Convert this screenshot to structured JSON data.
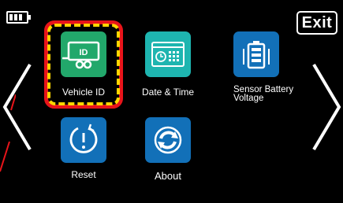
{
  "header": {
    "battery_icon": "battery-icon",
    "exit_label": "Exit"
  },
  "menu": {
    "items": [
      {
        "label": "Vehicle ID",
        "icon": "trailer-id-icon",
        "color": "#22a86b",
        "selected": true
      },
      {
        "label": "Date & Time",
        "icon": "calendar-clock-icon",
        "color": "#1eb5b0",
        "selected": false
      },
      {
        "label_line1": "Sensor Battery",
        "label_line2": "Voltage",
        "icon": "battery-level-icon",
        "color": "#1270b8",
        "selected": false
      },
      {
        "label": "Reset",
        "icon": "power-reset-icon",
        "color": "#1270b8",
        "selected": false
      },
      {
        "label": "About",
        "icon": "refresh-about-icon",
        "color": "#1270b8",
        "selected": false
      }
    ]
  },
  "navigation": {
    "prev_icon": "chevron-left-icon",
    "next_icon": "chevron-right-icon"
  },
  "colors": {
    "selection_outer": "#e8141a",
    "selection_dash": "#ffd600",
    "background": "#000000"
  }
}
